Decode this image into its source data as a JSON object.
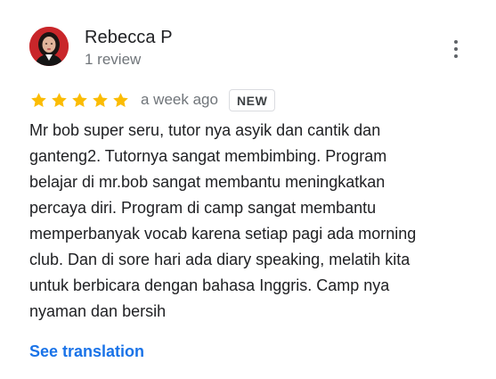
{
  "review": {
    "author": {
      "name": "Rebecca P",
      "meta": "1 review"
    },
    "rating": {
      "stars": 5,
      "max": 5,
      "star_color": "#fbbc04"
    },
    "timestamp": "a week ago",
    "badge": "NEW",
    "text_lines": [
      "Mr bob super seru, tutor nya asyik dan cantik dan",
      "ganteng2. Tutornya sangat membimbing. Program",
      "belajar di mr.bob sangat membantu meningkatkan",
      "percaya diri. Program di camp sangat membantu",
      "memperbanyak vocab karena setiap pagi ada morning",
      "club. Dan di sore hari ada diary speaking, melatih kita",
      "untuk berbicara dengan bahasa Inggris. Camp nya",
      "nyaman dan bersih"
    ],
    "translate_label": "See translation",
    "link_color": "#1a73e8",
    "more_icon": "more-vert-icon"
  }
}
